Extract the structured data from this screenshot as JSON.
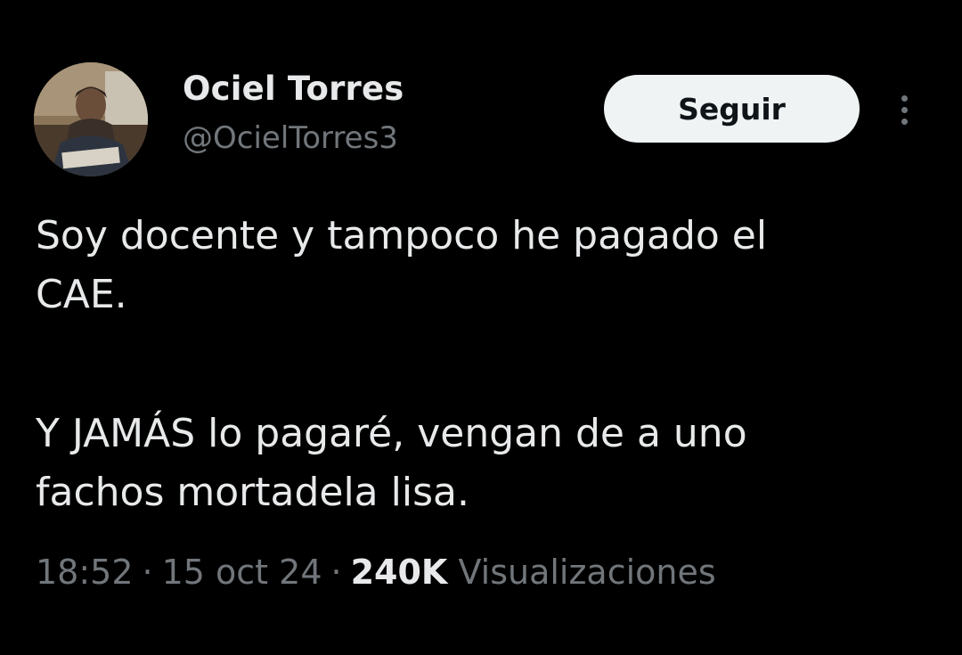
{
  "author": {
    "display_name": "Ociel Torres",
    "handle": "@OcielTorres3"
  },
  "actions": {
    "follow_label": "Seguir"
  },
  "tweet": {
    "lines_paragraph_1": [
      "Soy docente y tampoco he pagado el",
      "CAE."
    ],
    "lines_paragraph_2": [
      "Y JAMÁS lo pagaré, vengan de a uno",
      "fachos mortadela lisa."
    ]
  },
  "meta": {
    "time": "18:52",
    "separator": "·",
    "date": "15 oct 24",
    "views_count": "240K",
    "views_label": "Visualizaciones"
  },
  "colors": {
    "background": "#000000",
    "primary_text": "#e7e9ea",
    "secondary_text": "#71767b",
    "follow_button_bg": "#eff3f4",
    "follow_button_text": "#0f1419"
  },
  "icons": {
    "more": "more-vertical-icon"
  }
}
